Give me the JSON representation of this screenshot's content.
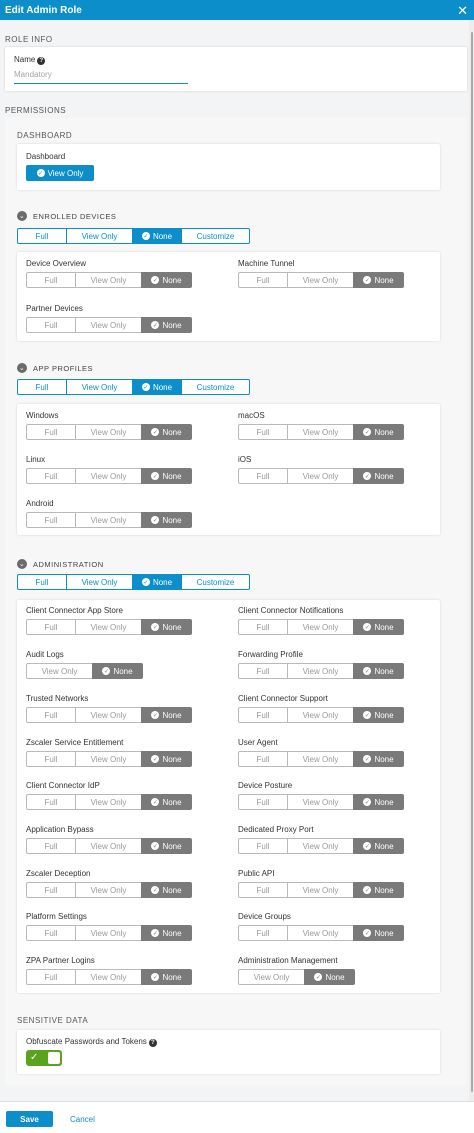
{
  "header": {
    "title": "Edit Admin Role"
  },
  "role_info": {
    "section": "ROLE INFO",
    "name_label": "Name",
    "name_placeholder": "Mandatory"
  },
  "permissions": {
    "section": "PERMISSIONS"
  },
  "dashboard": {
    "section": "DASHBOARD",
    "label": "Dashboard",
    "value": "View Only"
  },
  "enrolled_devices": {
    "section": "ENROLLED DEVICES",
    "options": [
      "Full",
      "View Only",
      "None",
      "Customize"
    ],
    "selected": "None",
    "items": [
      {
        "label": "Device Overview",
        "options": [
          "Full",
          "View Only",
          "None"
        ],
        "selected": "None"
      },
      {
        "label": "Machine Tunnel",
        "options": [
          "Full",
          "View Only",
          "None"
        ],
        "selected": "None"
      },
      {
        "label": "Partner Devices",
        "options": [
          "Full",
          "View Only",
          "None"
        ],
        "selected": "None"
      }
    ]
  },
  "app_profiles": {
    "section": "APP PROFILES",
    "options": [
      "Full",
      "View Only",
      "None",
      "Customize"
    ],
    "selected": "None",
    "items": [
      {
        "label": "Windows",
        "options": [
          "Full",
          "View Only",
          "None"
        ],
        "selected": "None"
      },
      {
        "label": "macOS",
        "options": [
          "Full",
          "View Only",
          "None"
        ],
        "selected": "None"
      },
      {
        "label": "Linux",
        "options": [
          "Full",
          "View Only",
          "None"
        ],
        "selected": "None"
      },
      {
        "label": "iOS",
        "options": [
          "Full",
          "View Only",
          "None"
        ],
        "selected": "None"
      },
      {
        "label": "Android",
        "options": [
          "Full",
          "View Only",
          "None"
        ],
        "selected": "None"
      }
    ]
  },
  "administration": {
    "section": "ADMINISTRATION",
    "options": [
      "Full",
      "View Only",
      "None",
      "Customize"
    ],
    "selected": "None",
    "items": [
      {
        "label": "Client Connector App Store",
        "options": [
          "Full",
          "View Only",
          "None"
        ],
        "selected": "None"
      },
      {
        "label": "Client Connector Notifications",
        "options": [
          "Full",
          "View Only",
          "None"
        ],
        "selected": "None"
      },
      {
        "label": "Audit Logs",
        "options": [
          "View Only",
          "None"
        ],
        "selected": "None"
      },
      {
        "label": "Forwarding Profile",
        "options": [
          "Full",
          "View Only",
          "None"
        ],
        "selected": "None"
      },
      {
        "label": "Trusted Networks",
        "options": [
          "Full",
          "View Only",
          "None"
        ],
        "selected": "None"
      },
      {
        "label": "Client Connector Support",
        "options": [
          "Full",
          "View Only",
          "None"
        ],
        "selected": "None"
      },
      {
        "label": "Zscaler Service Entitlement",
        "options": [
          "Full",
          "View Only",
          "None"
        ],
        "selected": "None"
      },
      {
        "label": "User Agent",
        "options": [
          "Full",
          "View Only",
          "None"
        ],
        "selected": "None"
      },
      {
        "label": "Client Connector IdP",
        "options": [
          "Full",
          "View Only",
          "None"
        ],
        "selected": "None"
      },
      {
        "label": "Device Posture",
        "options": [
          "Full",
          "View Only",
          "None"
        ],
        "selected": "None"
      },
      {
        "label": "Application Bypass",
        "options": [
          "Full",
          "View Only",
          "None"
        ],
        "selected": "None"
      },
      {
        "label": "Dedicated Proxy Port",
        "options": [
          "Full",
          "View Only",
          "None"
        ],
        "selected": "None"
      },
      {
        "label": "Zscaler Deception",
        "options": [
          "Full",
          "View Only",
          "None"
        ],
        "selected": "None"
      },
      {
        "label": "Public API",
        "options": [
          "Full",
          "View Only",
          "None"
        ],
        "selected": "None"
      },
      {
        "label": "Platform Settings",
        "options": [
          "Full",
          "View Only",
          "None"
        ],
        "selected": "None"
      },
      {
        "label": "Device Groups",
        "options": [
          "Full",
          "View Only",
          "None"
        ],
        "selected": "None"
      },
      {
        "label": "ZPA Partner Logins",
        "options": [
          "Full",
          "View Only",
          "None"
        ],
        "selected": "None"
      },
      {
        "label": "Administration Management",
        "options": [
          "View Only",
          "None"
        ],
        "selected": "None"
      }
    ]
  },
  "sensitive_data": {
    "section": "SENSITIVE DATA",
    "label": "Obfuscate Passwords and Tokens",
    "enabled": true
  },
  "footer": {
    "save_label": "Save",
    "cancel_label": "Cancel"
  },
  "colors": {
    "accent": "#0b8ec9",
    "selected_gray": "#7a7a7a",
    "toggle_on": "#5aa31f"
  },
  "icons": {
    "close": "close-icon",
    "help": "help-icon",
    "chevron": "chevron-down-icon",
    "check": "check-icon"
  }
}
